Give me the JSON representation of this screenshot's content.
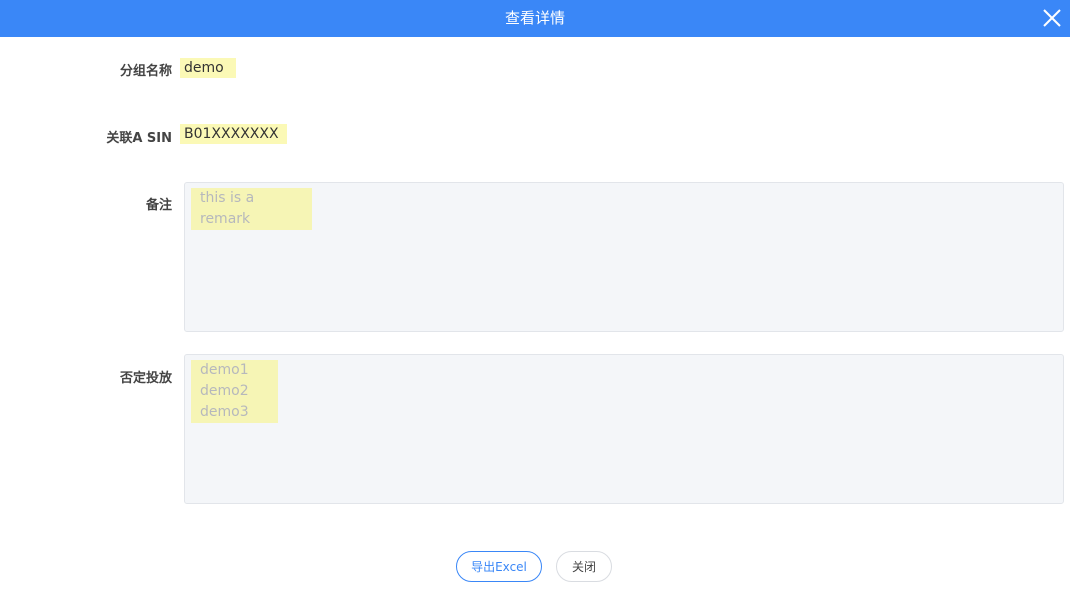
{
  "dialog": {
    "title": "查看详情",
    "close_icon": "close-icon"
  },
  "fields": {
    "group_name": {
      "label": "分组名称",
      "value": "demo"
    },
    "related_asin": {
      "label": "关联A SIN",
      "value": "B01XXXXXXX"
    },
    "remark": {
      "label": "备注",
      "value": "this is a remark"
    },
    "negative_targeting": {
      "label": "否定投放",
      "values": [
        "demo1",
        "demo2",
        "demo3"
      ]
    }
  },
  "buttons": {
    "export_label": "导出Excel",
    "close_label": "关闭"
  },
  "colors": {
    "header": "#3a87f7",
    "highlight": "#fbf9b6",
    "textarea_bg": "#f4f6f9"
  }
}
